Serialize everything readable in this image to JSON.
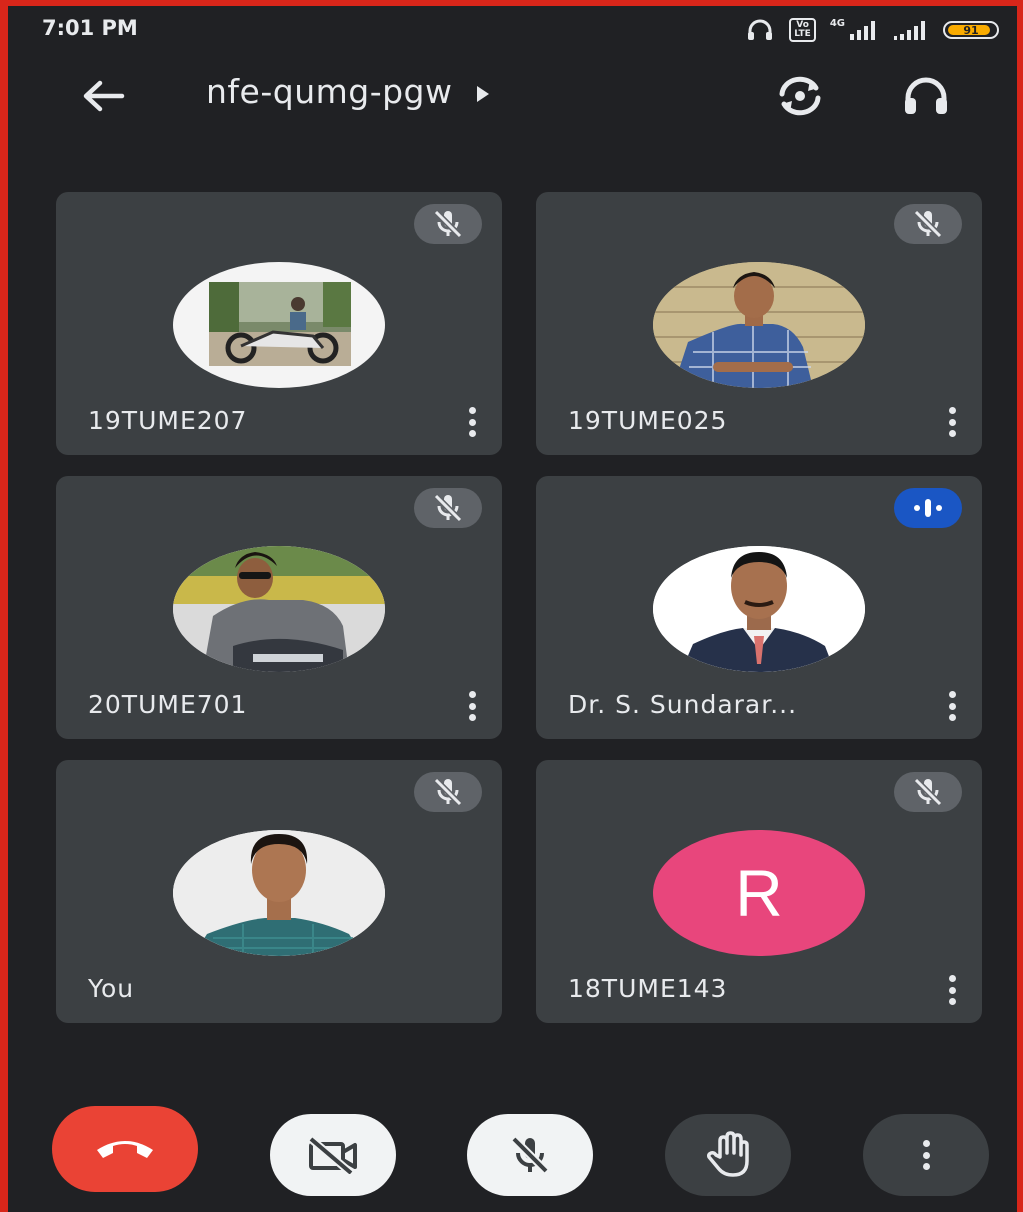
{
  "status_bar": {
    "time": "7:01 PM",
    "volte_top": "Vo",
    "volte_bottom": "LTE",
    "network_type": "4G",
    "battery_level": "91",
    "battery_fraction": 0.91,
    "icons": [
      "headphones-icon",
      "volte-icon",
      "signal-icon",
      "signal-icon",
      "battery-icon"
    ]
  },
  "header": {
    "meeting_code": "nfe-qumg-pgw",
    "icons": [
      "back-arrow-icon",
      "expand-caret-icon",
      "switch-camera-icon",
      "headphones-icon"
    ]
  },
  "participants": [
    {
      "name": "19TUME207",
      "mic": "muted",
      "avatar": "photo"
    },
    {
      "name": "19TUME025",
      "mic": "muted",
      "avatar": "photo"
    },
    {
      "name": "20TUME701",
      "mic": "muted",
      "avatar": "photo"
    },
    {
      "name": "Dr. S. Sundarar...",
      "mic": "speaking",
      "avatar": "photo"
    },
    {
      "name": "You",
      "mic": "muted",
      "avatar": "photo"
    },
    {
      "name": "18TUME143",
      "mic": "muted",
      "avatar": "letter",
      "initial": "R",
      "avatar_color": "#e8467c"
    }
  ],
  "controls": {
    "items": [
      "end-call",
      "camera-off",
      "mic-off",
      "raise-hand",
      "more-options"
    ],
    "end_call_color": "#ea4335",
    "speaking_color": "#1a56c4"
  }
}
